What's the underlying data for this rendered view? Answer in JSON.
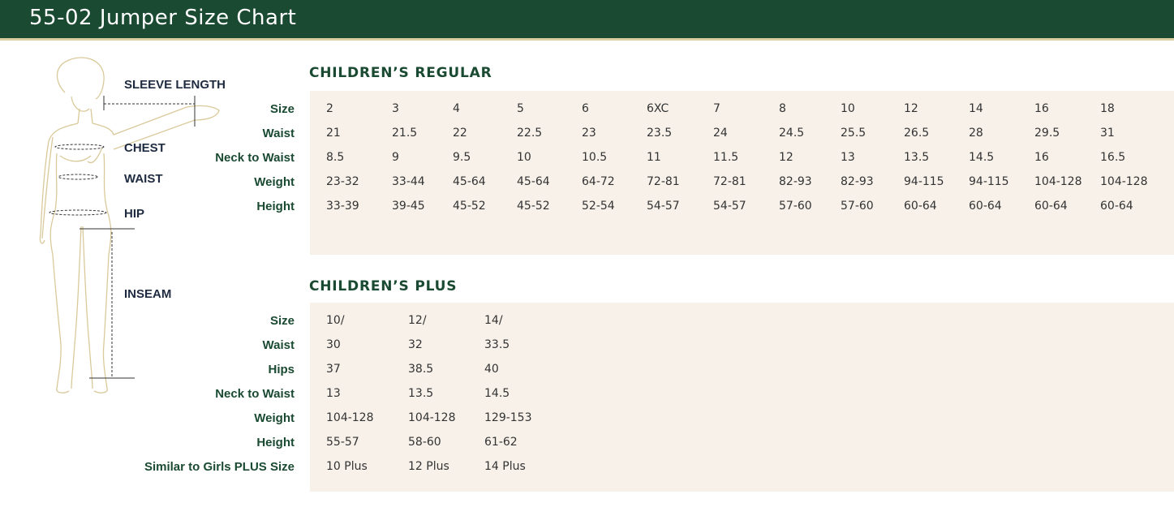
{
  "header": {
    "title": "55-02 Jumper Size Chart"
  },
  "figure": {
    "labels": [
      "SLEEVE LENGTH",
      "CHEST",
      "WAIST",
      "HIP",
      "INSEAM"
    ]
  },
  "regular": {
    "title": "CHILDREN’S REGULAR",
    "rows": [
      {
        "label": "Size",
        "values": [
          "2",
          "3",
          "4",
          "5",
          "6",
          "6XC",
          "7",
          "8",
          "10",
          "12",
          "14",
          "16",
          "18"
        ]
      },
      {
        "label": "Waist",
        "values": [
          "21",
          "21.5",
          "22",
          "22.5",
          "23",
          "23.5",
          "24",
          "24.5",
          "25.5",
          "26.5",
          "28",
          "29.5",
          "31"
        ]
      },
      {
        "label": "Neck to Waist",
        "values": [
          "8.5",
          "9",
          "9.5",
          "10",
          "10.5",
          "11",
          "11.5",
          "12",
          "13",
          "13.5",
          "14.5",
          "16",
          "16.5"
        ]
      },
      {
        "label": "Weight",
        "values": [
          "23-32",
          "33-44",
          "45-64",
          "45-64",
          "64-72",
          "72-81",
          "72-81",
          "82-93",
          "82-93",
          "94-115",
          "94-115",
          "104-128",
          "104-128"
        ]
      },
      {
        "label": "Height",
        "values": [
          "33-39",
          "39-45",
          "45-52",
          "45-52",
          "52-54",
          "54-57",
          "54-57",
          "57-60",
          "57-60",
          "60-64",
          "60-64",
          "60-64",
          "60-64"
        ]
      }
    ]
  },
  "plus": {
    "title": "CHILDREN’S PLUS",
    "rows": [
      {
        "label": "Size",
        "values": [
          "10/",
          "12/",
          "14/"
        ]
      },
      {
        "label": "Waist",
        "values": [
          "30",
          "32",
          "33.5"
        ]
      },
      {
        "label": "Hips",
        "values": [
          "37",
          "38.5",
          "40"
        ]
      },
      {
        "label": "Neck to Waist",
        "values": [
          "13",
          "13.5",
          "14.5"
        ]
      },
      {
        "label": "Weight",
        "values": [
          "104-128",
          "104-128",
          "129-153"
        ]
      },
      {
        "label": "Height",
        "values": [
          "55-57",
          "58-60",
          "61-62"
        ]
      },
      {
        "label": "Similar to Girls PLUS Size",
        "values": [
          "10 Plus",
          "12 Plus",
          "14 Plus"
        ]
      }
    ]
  },
  "colors": {
    "header_bg": "#1a4a31",
    "accent_gold": "#d9cfa0",
    "panel_bg": "#f7f1ea",
    "label_green": "#1a4a31"
  }
}
